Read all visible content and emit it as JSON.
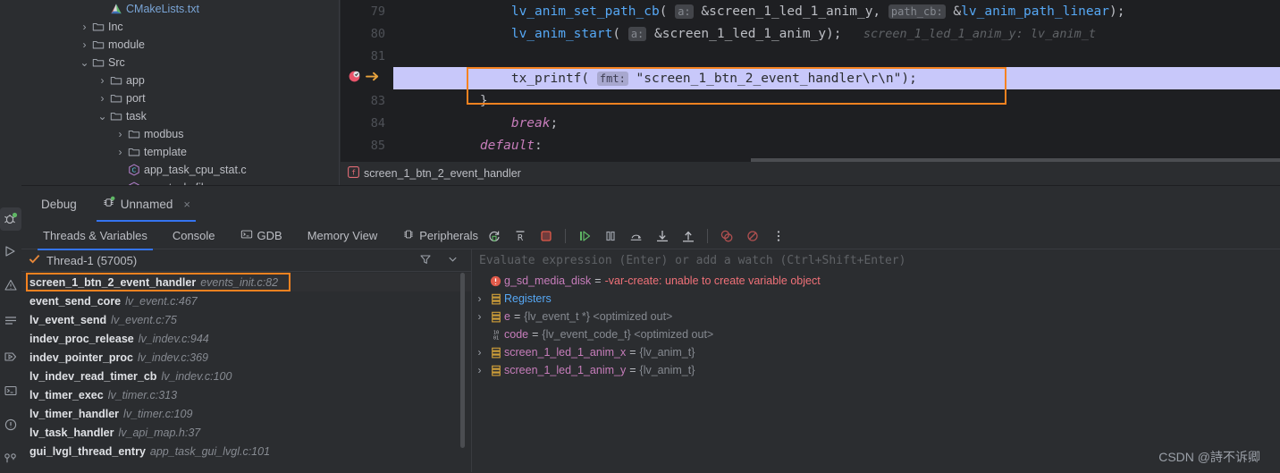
{
  "left_toolbar": {
    "items": [
      {
        "name": "debug-tool-window-icon",
        "glyph": "bug",
        "active": true
      },
      {
        "name": "run-tool-window-icon",
        "glyph": "play",
        "active": false
      },
      {
        "name": "problems-tool-window-icon",
        "glyph": "warning",
        "active": false
      },
      {
        "name": "todo-tool-window-icon",
        "glyph": "lines",
        "active": false
      },
      {
        "name": "services-tool-window-icon",
        "glyph": "play-outline",
        "active": false
      },
      {
        "name": "terminal-tool-window-icon",
        "glyph": "terminal",
        "active": false
      },
      {
        "name": "notifications-tool-window-icon",
        "glyph": "exclaim",
        "active": false
      },
      {
        "name": "git-tool-window-icon",
        "glyph": "branch",
        "active": false
      }
    ]
  },
  "project_tree": {
    "rows": [
      {
        "indent": 2,
        "chevron": "",
        "icon": "cmake-file",
        "label": "CMakeLists.txt",
        "style": "blue"
      },
      {
        "indent": 1,
        "chevron": "›",
        "icon": "folder",
        "label": "Inc",
        "style": "plain"
      },
      {
        "indent": 1,
        "chevron": "›",
        "icon": "folder",
        "label": "module",
        "style": "plain"
      },
      {
        "indent": 1,
        "chevron": "⌄",
        "icon": "folder",
        "label": "Src",
        "style": "plain"
      },
      {
        "indent": 2,
        "chevron": "›",
        "icon": "folder",
        "label": "app",
        "style": "plain"
      },
      {
        "indent": 2,
        "chevron": "›",
        "icon": "folder",
        "label": "port",
        "style": "plain"
      },
      {
        "indent": 2,
        "chevron": "⌄",
        "icon": "folder",
        "label": "task",
        "style": "plain"
      },
      {
        "indent": 3,
        "chevron": "›",
        "icon": "folder",
        "label": "modbus",
        "style": "plain"
      },
      {
        "indent": 3,
        "chevron": "›",
        "icon": "folder",
        "label": "template",
        "style": "plain"
      },
      {
        "indent": 3,
        "chevron": "",
        "icon": "c-file",
        "label": "app_task_cpu_stat.c",
        "style": "plain"
      },
      {
        "indent": 3,
        "chevron": "",
        "icon": "c-file",
        "label": "app_task_file.c",
        "style": "plain"
      }
    ]
  },
  "editor": {
    "lines": [
      {
        "number": "79",
        "current": false,
        "tokens": [
          {
            "t": "        ",
            "c": "id"
          },
          {
            "t": "lv_anim_set_path_cb",
            "c": "fn"
          },
          {
            "t": "(",
            "c": "punc"
          },
          {
            "t": " ",
            "c": "id"
          },
          {
            "t": "a:",
            "c": "hint"
          },
          {
            "t": " &screen_1_led_1_anim_y, ",
            "c": "id"
          },
          {
            "t": "path_cb:",
            "c": "hint"
          },
          {
            "t": " &",
            "c": "id"
          },
          {
            "t": "lv_anim_path_linear",
            "c": "fn"
          },
          {
            "t": ");",
            "c": "punc"
          }
        ]
      },
      {
        "number": "80",
        "current": false,
        "tokens": [
          {
            "t": "        ",
            "c": "id"
          },
          {
            "t": "lv_anim_start",
            "c": "fn"
          },
          {
            "t": "(",
            "c": "punc"
          },
          {
            "t": " ",
            "c": "id"
          },
          {
            "t": "a:",
            "c": "hint"
          },
          {
            "t": " &screen_1_led_1_anim_y);",
            "c": "id"
          },
          {
            "t": "   screen_1_led_1_anim_y: lv_anim_t",
            "c": "inlinehint"
          }
        ]
      },
      {
        "number": "81",
        "current": false,
        "tokens": []
      },
      {
        "number": "82",
        "current": true,
        "breakpoint": true,
        "arrow": true,
        "tokens": [
          {
            "t": "        ",
            "c": "dk"
          },
          {
            "t": "tx_printf",
            "c": "dk"
          },
          {
            "t": "( ",
            "c": "dk"
          },
          {
            "t": "fmt:",
            "c": "dkhint"
          },
          {
            "t": " \"screen_1_btn_2_event_handler\\r\\n\");",
            "c": "dk"
          }
        ]
      },
      {
        "number": "83",
        "current": false,
        "tokens": [
          {
            "t": "    }",
            "c": "id"
          }
        ]
      },
      {
        "number": "84",
        "current": false,
        "tokens": [
          {
            "t": "        ",
            "c": "id"
          },
          {
            "t": "break",
            "c": "kw2"
          },
          {
            "t": ";",
            "c": "punc"
          }
        ]
      },
      {
        "number": "85",
        "current": false,
        "tokens": [
          {
            "t": "    ",
            "c": "id"
          },
          {
            "t": "default",
            "c": "kw2"
          },
          {
            "t": ":",
            "c": "punc"
          }
        ]
      }
    ]
  },
  "breadcrumb": {
    "icon": "function-icon",
    "label": "screen_1_btn_2_event_handler"
  },
  "debug": {
    "tabs": [
      {
        "label": "Debug",
        "selected": false,
        "icon": "",
        "closeable": false
      },
      {
        "label": "Unnamed",
        "selected": true,
        "icon": "debug-config-icon",
        "closeable": true,
        "close": "×"
      }
    ],
    "view_tabs": [
      {
        "label": "Threads & Variables",
        "selected": true,
        "icon": ""
      },
      {
        "label": "Console",
        "selected": false,
        "icon": ""
      },
      {
        "label": "GDB",
        "selected": false,
        "icon": "terminal-icon"
      },
      {
        "label": "Memory View",
        "selected": false,
        "icon": ""
      },
      {
        "label": "Peripherals",
        "selected": false,
        "icon": "chip-icon"
      }
    ],
    "toolbar_buttons": [
      {
        "name": "rerun-debug-button",
        "glyph": "rerun"
      },
      {
        "name": "restart-button",
        "glyph": "restart-R"
      },
      {
        "name": "stop-button",
        "glyph": "stop"
      },
      {
        "name": "separator-1",
        "glyph": "sep"
      },
      {
        "name": "resume-program-button",
        "glyph": "resume"
      },
      {
        "name": "pause-program-button",
        "glyph": "pause"
      },
      {
        "name": "step-over-button",
        "glyph": "step-over"
      },
      {
        "name": "step-into-button",
        "glyph": "step-into"
      },
      {
        "name": "step-out-button",
        "glyph": "step-out"
      },
      {
        "name": "separator-2",
        "glyph": "sep"
      },
      {
        "name": "view-breakpoints-button",
        "glyph": "breakpoints"
      },
      {
        "name": "mute-breakpoints-button",
        "glyph": "mute-breakpoints"
      },
      {
        "name": "more-options-button",
        "glyph": "more"
      }
    ],
    "thread": {
      "status_icon": "check-icon",
      "label": "Thread-1 (57005)",
      "filter_icon": "filter-icon",
      "dropdown_icon": "chevron-down-icon"
    },
    "frames": [
      {
        "name": "screen_1_btn_2_event_handler",
        "location": "events_init.c:82",
        "selected": true
      },
      {
        "name": "event_send_core",
        "location": "lv_event.c:467",
        "selected": false
      },
      {
        "name": "lv_event_send",
        "location": "lv_event.c:75",
        "selected": false
      },
      {
        "name": "indev_proc_release",
        "location": "lv_indev.c:944",
        "selected": false
      },
      {
        "name": "indev_pointer_proc",
        "location": "lv_indev.c:369",
        "selected": false
      },
      {
        "name": "lv_indev_read_timer_cb",
        "location": "lv_indev.c:100",
        "selected": false
      },
      {
        "name": "lv_timer_exec",
        "location": "lv_timer.c:313",
        "selected": false
      },
      {
        "name": "lv_timer_handler",
        "location": "lv_timer.c:109",
        "selected": false
      },
      {
        "name": "lv_task_handler",
        "location": "lv_api_map.h:37",
        "selected": false
      },
      {
        "name": "gui_lvgl_thread_entry",
        "location": "app_task_gui_lvgl.c:101",
        "selected": false
      }
    ],
    "evaluate_placeholder": "Evaluate expression (Enter) or add a watch (Ctrl+Shift+Enter)",
    "variables": [
      {
        "chevron": "",
        "icon": "error-icon",
        "name": "g_sd_media_disk",
        "eq": "=",
        "value": "-var-create: unable to create variable object",
        "value_style": "err",
        "name_style": "pink"
      },
      {
        "chevron": "›",
        "icon": "registers-icon",
        "name": "Registers",
        "eq": "",
        "value": "",
        "value_style": "gray",
        "name_style": "blue"
      },
      {
        "chevron": "›",
        "icon": "object-icon",
        "name": "e",
        "eq": "=",
        "value": "{lv_event_t *} <optimized out>",
        "value_style": "gray",
        "name_style": "pink"
      },
      {
        "chevron": "",
        "icon": "primitive-icon",
        "name": "code",
        "eq": "=",
        "value": "{lv_event_code_t} <optimized out>",
        "value_style": "gray",
        "name_style": "pink"
      },
      {
        "chevron": "›",
        "icon": "object-icon",
        "name": "screen_1_led_1_anim_x",
        "eq": "=",
        "value": "{lv_anim_t}",
        "value_style": "gray",
        "name_style": "pink"
      },
      {
        "chevron": "›",
        "icon": "object-icon",
        "name": "screen_1_led_1_anim_y",
        "eq": "=",
        "value": "{lv_anim_t}",
        "value_style": "gray",
        "name_style": "pink"
      }
    ]
  },
  "watermark": "CSDN @詩不诉卿",
  "colors": {
    "bg": "#2b2d30",
    "editor_bg": "#1e1f22",
    "accent_blue": "#3574f0",
    "accent_orange": "#f58220",
    "highlight_line": "#c8c8fa",
    "error_red": "#f07178"
  }
}
